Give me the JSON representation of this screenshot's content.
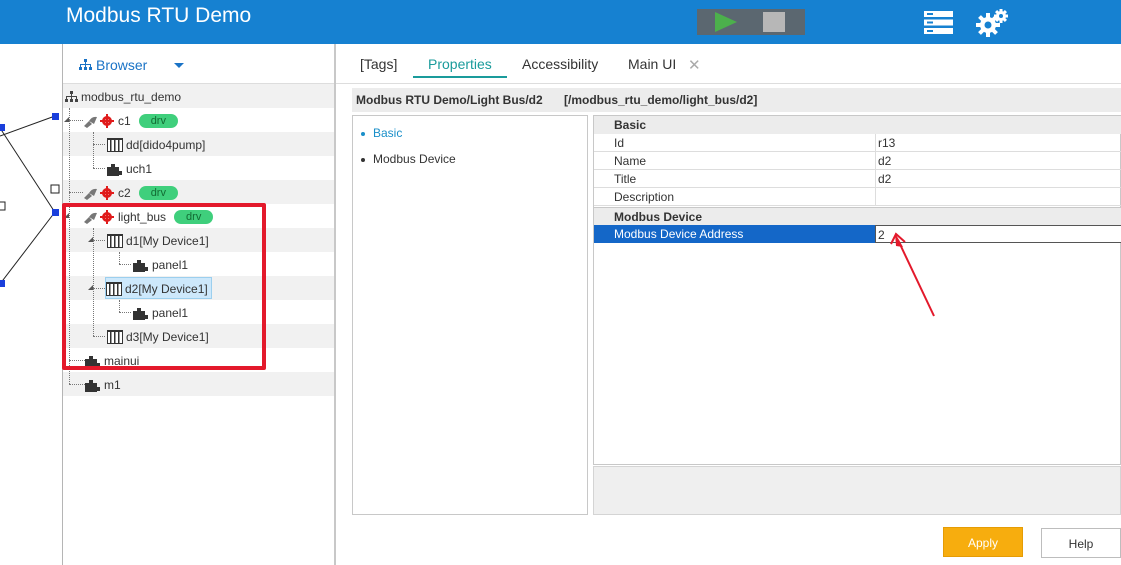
{
  "app": {
    "title": "Modbus RTU Demo"
  },
  "browser": {
    "title": "Browser",
    "tree": {
      "root": "modbus_rtu_demo",
      "c1": "c1",
      "c1_badge": "drv",
      "dd": "dd[dido4pump]",
      "uch1": "uch1",
      "c2": "c2",
      "c2_badge": "drv",
      "light_bus": "light_bus",
      "light_bus_badge": "drv",
      "d1": "d1[My Device1]",
      "d1_panel": "panel1",
      "d2": "d2[My Device1]",
      "d2_panel": "panel1",
      "d3": "d3[My Device1]",
      "mainui": "mainui",
      "m1": "m1"
    }
  },
  "tabs": [
    {
      "label": "[Tags]"
    },
    {
      "label": "Properties"
    },
    {
      "label": "Accessibility"
    },
    {
      "label": "Main UI"
    }
  ],
  "tab_close": "✕",
  "path": {
    "title": "Modbus RTU Demo/Light Bus/d2",
    "path": "[/modbus_rtu_demo/light_bus/d2]"
  },
  "nav": [
    {
      "label": "Basic"
    },
    {
      "label": "Modbus Device"
    }
  ],
  "properties": {
    "basic_header": "Basic",
    "rows": [
      {
        "key": "Id",
        "value": "r13"
      },
      {
        "key": "Name",
        "value": "d2"
      },
      {
        "key": "Title",
        "value": "d2"
      },
      {
        "key": "Description",
        "value": ""
      }
    ],
    "modbus_header": "Modbus Device",
    "address_key": "Modbus Device Address",
    "address_value": "2"
  },
  "buttons": {
    "apply": "Apply",
    "help": "Help"
  },
  "colors": {
    "header": "#1681d1",
    "accent_tab": "#1a9b9b",
    "selection": "#1467c8",
    "apply": "#f7ad0e",
    "highlight_box": "#e3192b"
  }
}
